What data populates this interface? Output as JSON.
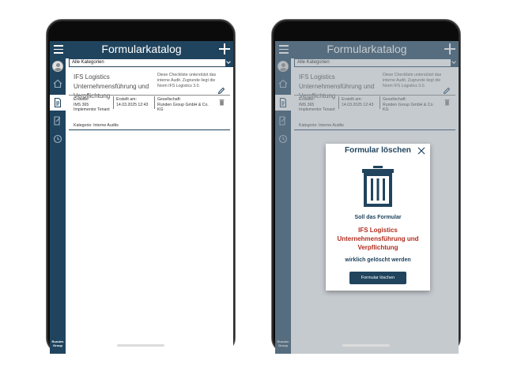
{
  "app": {
    "title": "Formularkatalog",
    "category_selected": "Alle Kategorien",
    "logo_text": "Runden Group"
  },
  "card": {
    "title": "IFS Logistics Unternehmensführung und Verpflichtung",
    "description": "Diese Checkliste unterstützt das interne Audit. Zugrunde liegt die Norm IFS Logistics 3.0.",
    "creator_label": "Ersteller:",
    "creator_value": "IMS 365 Implementor Tenant",
    "created_label": "Erstellt am:",
    "created_value": "14.03.2025 12:43",
    "company_label": "Gesellschaft:",
    "company_value": "Runden Group GmbH & Co. KG",
    "category_line": "Kategorie: Interne Audits"
  },
  "dialog": {
    "title": "Formular löschen",
    "line1": "Soll das Formular",
    "form_name": "IFS Logistics Unternehmensführung und Verpflichtung",
    "line3": "wirklich gelöscht werden",
    "button": "Formular löschen"
  },
  "colors": {
    "brand": "#20445e",
    "danger_text": "#b22d1f"
  }
}
